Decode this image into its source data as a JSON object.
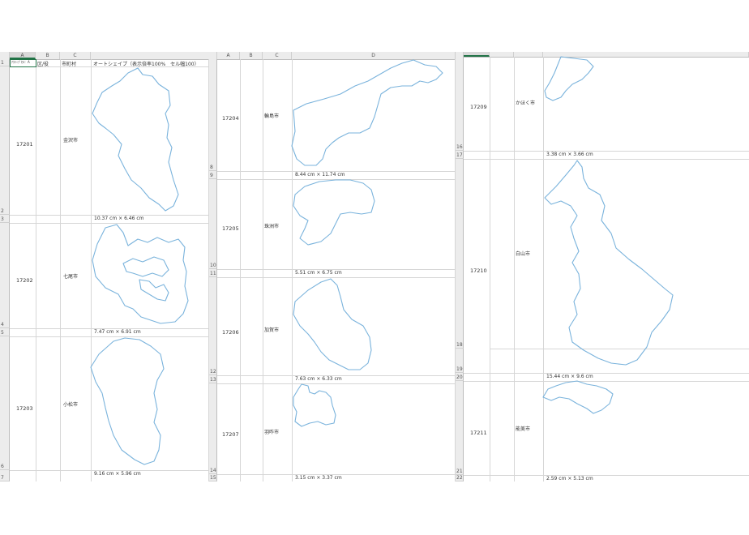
{
  "panel1": {
    "columns": [
      "A",
      "B",
      "C"
    ],
    "row1": {
      "a": "ｱｸﾃｨﾌﾞｾﾙ：A",
      "b": "区/役",
      "c": "市町村",
      "d": "オートシェイプ（表示倍率100%　セル幅100）"
    },
    "rows": [
      {
        "code": "17201",
        "city": "金沢市",
        "row_above": "2",
        "row_dim": "3",
        "dim": "10.37 cm × 6.46 cm"
      },
      {
        "code": "17202",
        "city": "七尾市",
        "row_above": "4",
        "row_dim": "5",
        "dim": "7.47 cm × 6.91 cm"
      },
      {
        "code": "17203",
        "city": "小松市",
        "row_above": "6",
        "row_dim": "7",
        "dim": "9.16 cm × 5.96 cm"
      }
    ],
    "row1_num": "1"
  },
  "panel2": {
    "columns": [
      "A",
      "B",
      "C",
      "D"
    ],
    "rows": [
      {
        "code": "17204",
        "city": "輪島市",
        "row_above": "8",
        "row_dim": "9",
        "dim": "8.44 cm × 11.74 cm"
      },
      {
        "code": "17205",
        "city": "珠洲市",
        "row_above": "10",
        "row_dim": "11",
        "dim": "5.51 cm × 6.75 cm"
      },
      {
        "code": "17206",
        "city": "加賀市",
        "row_above": "12",
        "row_dim": "13",
        "dim": "7.63 cm × 6.33 cm"
      },
      {
        "code": "17207",
        "city": "羽咋市",
        "row_above": "14",
        "row_dim": "15",
        "dim": "3.15 cm × 3.37 cm"
      }
    ]
  },
  "panel3": {
    "rows": [
      {
        "code": "17209",
        "city": "かほく市",
        "row_above": "16",
        "row_dim": "17",
        "dim": "3.38 cm × 3.66 cm"
      },
      {
        "code": "17210",
        "city": "白山市",
        "row_above": "18",
        "row_mid": "19",
        "row_dim": "20",
        "dim": "15.44 cm × 9.6 cm"
      },
      {
        "code": "17211",
        "city": "能美市",
        "row_above": "21",
        "row_dim": "22",
        "dim": "2.59 cm × 5.13 cm"
      }
    ]
  }
}
